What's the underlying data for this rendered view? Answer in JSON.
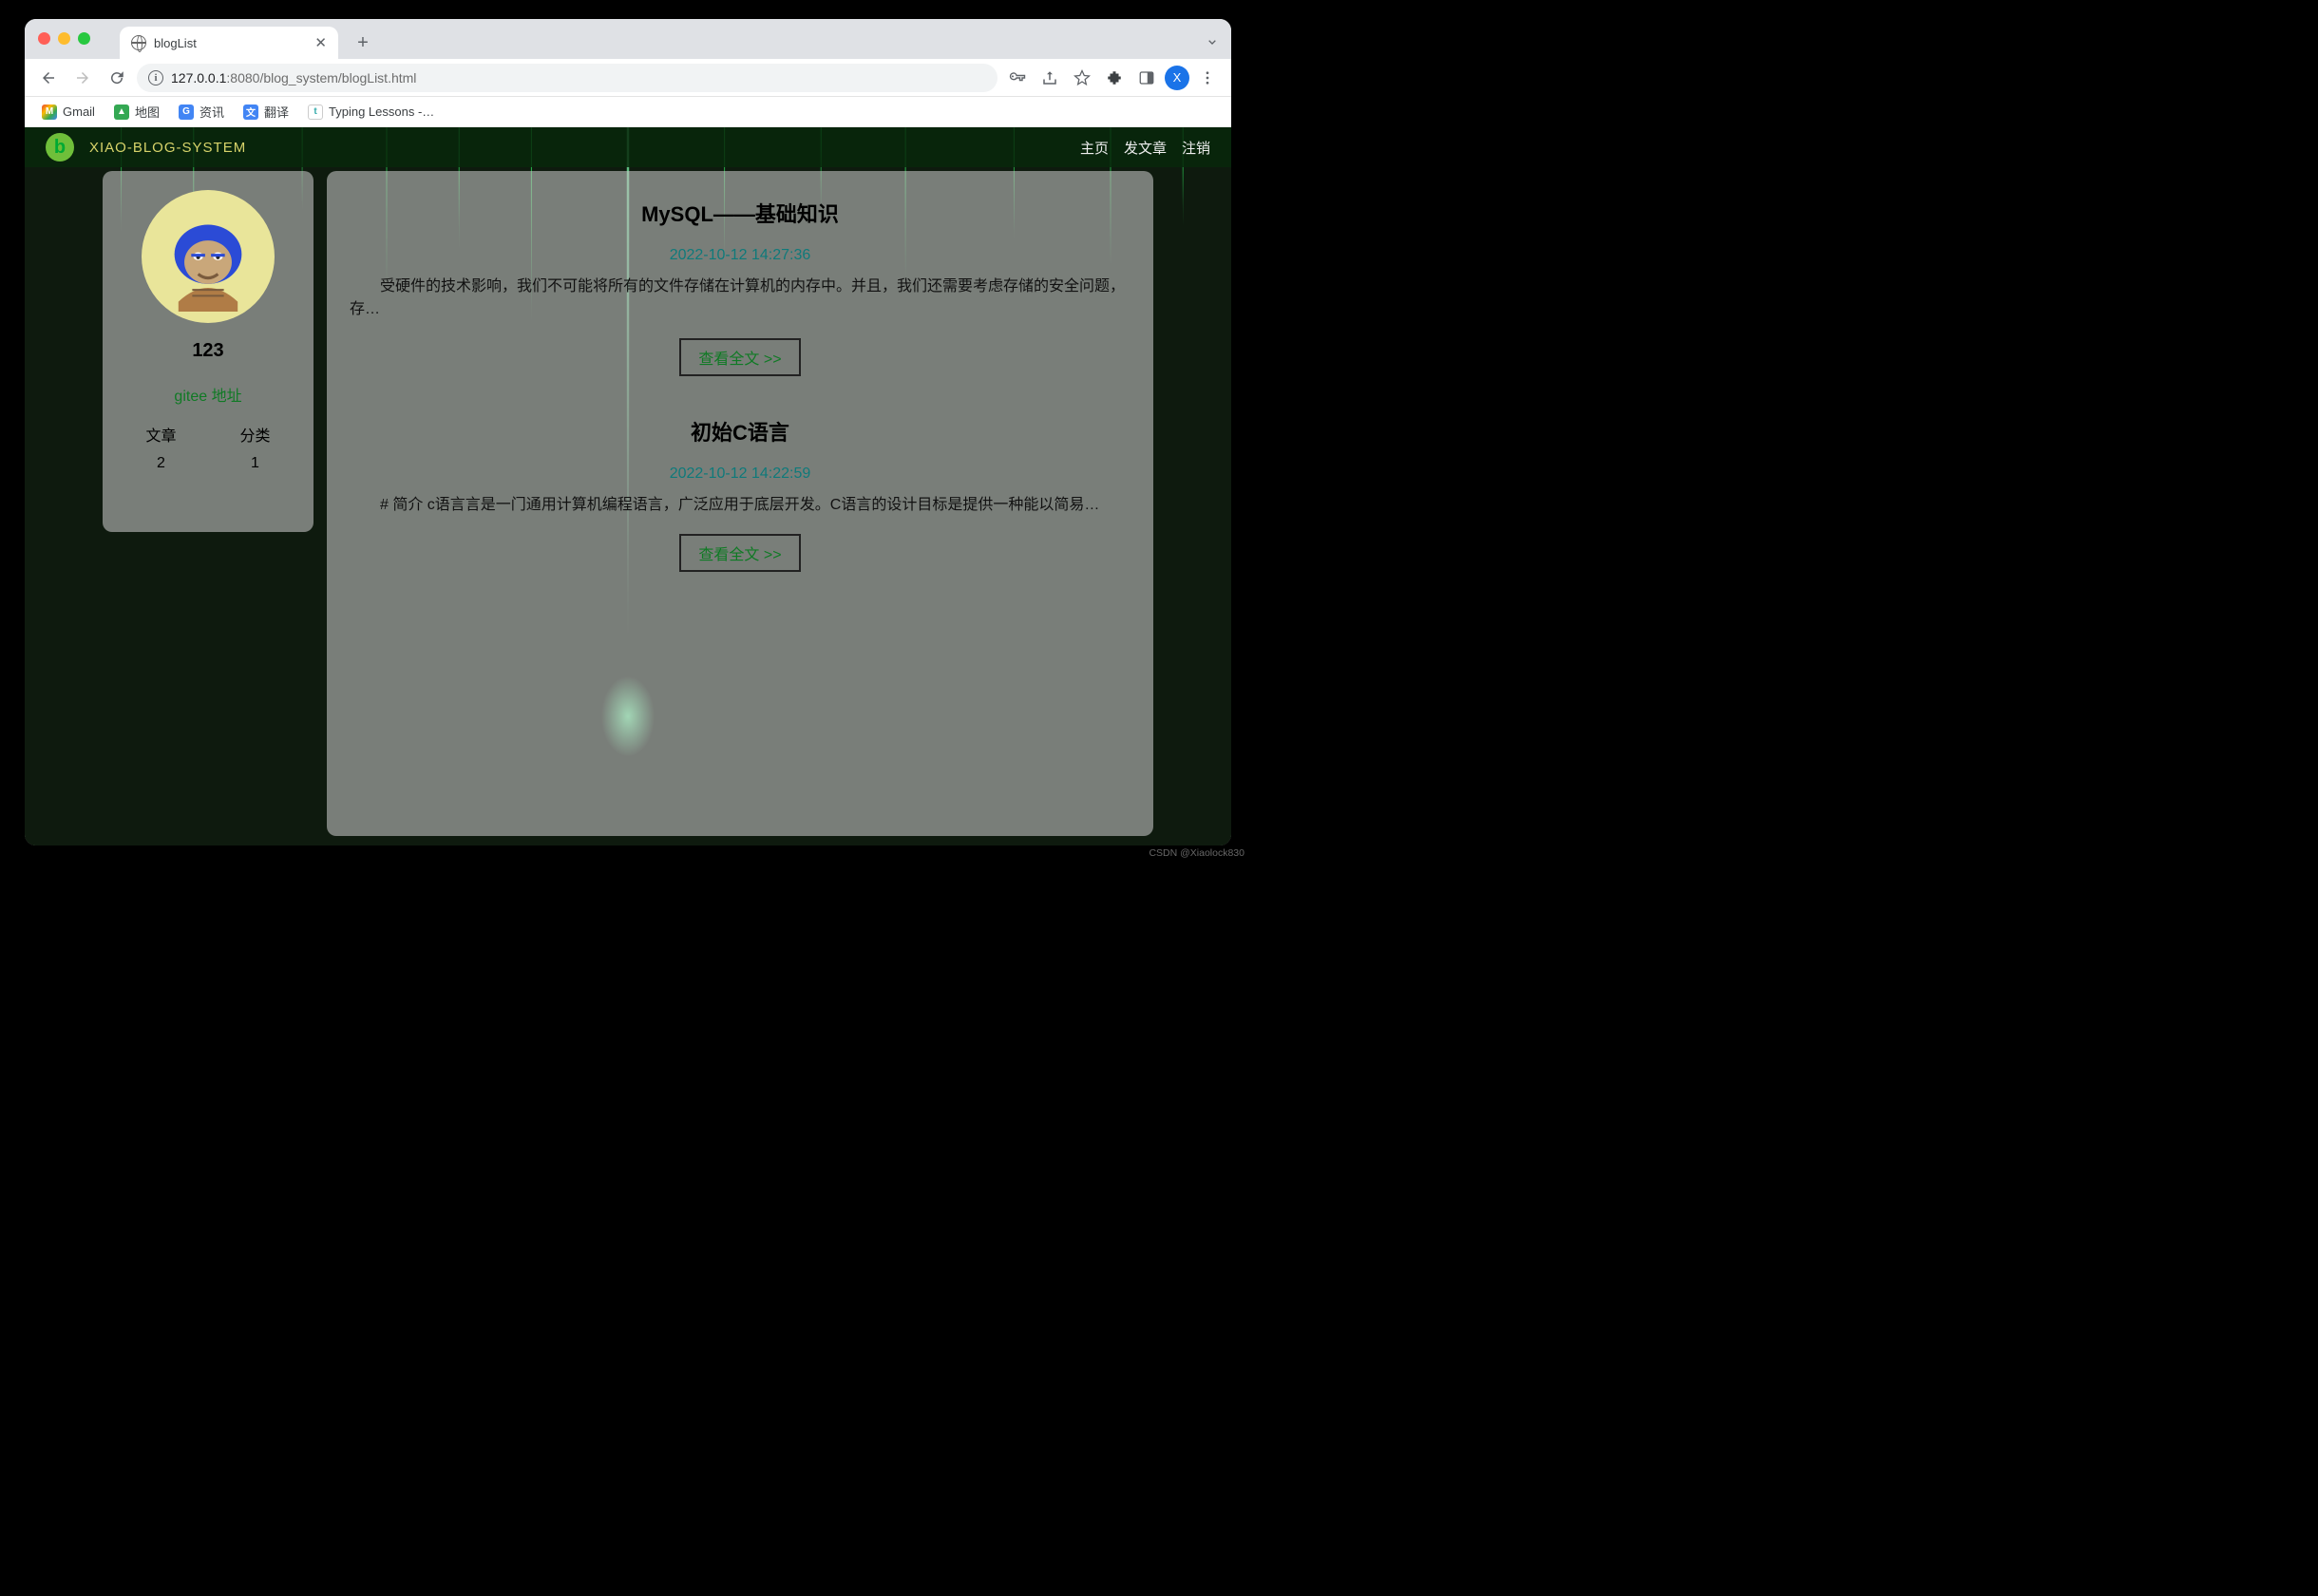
{
  "browser": {
    "tab_title": "blogList",
    "url_host": "127.0.0.1",
    "url_port": ":8080",
    "url_path": "/blog_system/blogList.html",
    "profile_initial": "X",
    "bookmarks": [
      {
        "label": "Gmail"
      },
      {
        "label": "地图"
      },
      {
        "label": "资讯"
      },
      {
        "label": "翻译"
      },
      {
        "label": "Typing Lessons -…"
      }
    ]
  },
  "site": {
    "brand": "XIAO-BLOG-SYSTEM",
    "nav": {
      "home": "主页",
      "write": "发文章",
      "logout": "注销"
    }
  },
  "profile": {
    "username": "123",
    "gitee_label": "gitee 地址",
    "stats": {
      "articles_label": "文章",
      "categories_label": "分类",
      "articles_count": "2",
      "categories_count": "1"
    }
  },
  "posts": [
    {
      "title": "MySQL——基础知识",
      "date": "2022-10-12 14:27:36",
      "excerpt": "受硬件的技术影响，我们不可能将所有的文件存储在计算机的内存中。并且，我们还需要考虑存储的安全问题，存…",
      "read_more": "查看全文 >>"
    },
    {
      "title": "初始C语言",
      "date": "2022-10-12 14:22:59",
      "excerpt": "# 简介 c语言言是一门通用计算机编程语言，广泛应用于底层开发。C语言的设计目标是提供一种能以简易…",
      "read_more": "查看全文 >>"
    }
  ],
  "watermark": "CSDN @Xiaolock830"
}
